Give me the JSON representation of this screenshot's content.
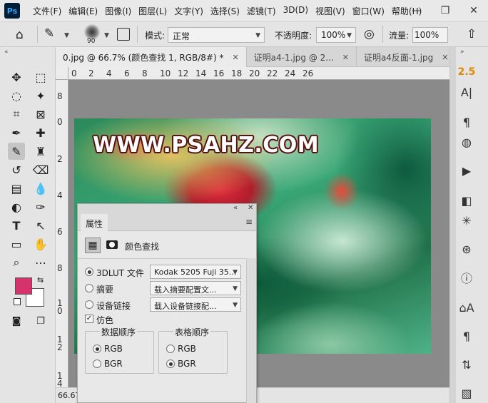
{
  "app": {
    "logo": "Ps"
  },
  "menu": [
    "文件(F)",
    "编辑(E)",
    "图像(I)",
    "图层(L)",
    "文字(Y)",
    "选择(S)",
    "滤镜(T)",
    "3D(D)",
    "视图(V)",
    "窗口(W)",
    "帮助(H)"
  ],
  "window_controls": {
    "minimize": "—",
    "restore": "❐",
    "close": "✕"
  },
  "options": {
    "brush_size": "90",
    "mode_label": "模式:",
    "mode_value": "正常",
    "opacity_label": "不透明度:",
    "opacity_value": "100%",
    "flow_label": "流量:",
    "flow_value": "100%"
  },
  "tabs": [
    {
      "label": "0.jpg @ 66.7% (颜色查找 1, RGB/8#) *",
      "close": "✕"
    },
    {
      "label": "证明a4-1.jpg @ 2...",
      "close": "✕"
    },
    {
      "label": "证明a4反面-1.jpg",
      "close": "✕"
    }
  ],
  "ruler": {
    "top": [
      "0",
      "2",
      "4",
      "6",
      "8",
      "10",
      "12",
      "14",
      "16",
      "18",
      "20",
      "22",
      "24",
      "26"
    ],
    "left": [
      "8",
      "0",
      "2",
      "4",
      "6",
      "8",
      "1\n0",
      "1\n2",
      "1\n4",
      "1\n6",
      "1\n8"
    ]
  },
  "canvas": {
    "watermark": "WWW.PSAHZ.COM"
  },
  "status": {
    "zoom": "66.67"
  },
  "right_panel": {
    "number": "2.5"
  },
  "properties": {
    "tab_label": "属性",
    "collapse": "«",
    "close": "✕",
    "menu": "≡",
    "adjust_title": "颜色查找",
    "lut_label": "3DLUT 文件",
    "lut_value": "Kodak 5205 Fuji 35...",
    "abstract_label": "摘要",
    "abstract_value": "载入摘要配置文...",
    "devicelink_label": "设备链接",
    "devicelink_value": "载入设备链接配...",
    "dither_label": "仿色",
    "data_order_title": "数据顺序",
    "data_order_options": [
      "RGB",
      "BGR"
    ],
    "data_order_selected": "RGB",
    "table_order_title": "表格顺序",
    "table_order_options": [
      "RGB",
      "BGR"
    ],
    "table_order_selected": "BGR"
  },
  "colors": {
    "foreground": "#d6336c",
    "background": "#ffffff",
    "accent_number": "#e08800"
  }
}
